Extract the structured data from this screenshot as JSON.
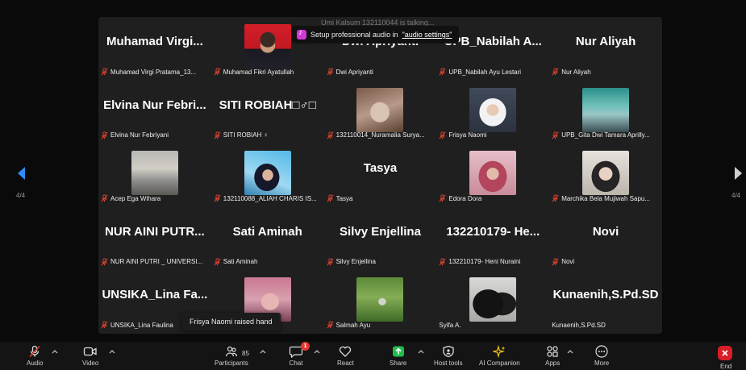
{
  "meeting": {
    "talking_text": "Umi Kalsum 132110044 is talking...",
    "audio_banner": {
      "text": "Setup professional audio in ",
      "link": "\"audio settings\""
    },
    "raised_hand": "Frisya Naomi raised hand",
    "page_left": "4/4",
    "page_right": "4/4"
  },
  "tiles": [
    {
      "big": "Muhamad Virgi...",
      "label": "Muhamad Virgi Pratama_13...",
      "photo": ""
    },
    {
      "big": "",
      "label": "Muhamad Fikri Ayatullah",
      "photo": "portrait-red"
    },
    {
      "big": "Dwi Apriyanti",
      "label": "Dwi Apriyanti",
      "photo": ""
    },
    {
      "big": "UPB_Nabilah A...",
      "label": "UPB_Nabilah Ayu Lestari",
      "photo": ""
    },
    {
      "big": "Nur Aliyah",
      "label": "Nur Aliyah",
      "photo": ""
    },
    {
      "big": "Elvina Nur Febri...",
      "label": "Elvina Nur Febriyani",
      "photo": ""
    },
    {
      "big": "SITI ROBIAH□♂□",
      "label": "SITI ROBIAH ♀",
      "photo": ""
    },
    {
      "big": "",
      "label": "132110014_Nuramalia Surya...",
      "photo": "selfie-light"
    },
    {
      "big": "",
      "label": "Frisya Naomi",
      "photo": "hijab-white"
    },
    {
      "big": "",
      "label": "UPB_Gita Dwi Tamara Aprilly...",
      "photo": "outdoor-teal"
    },
    {
      "big": "",
      "label": "Acep Ega Wihara",
      "photo": "street"
    },
    {
      "big": "",
      "label": "132110088_ALIAH CHARIS IS...",
      "photo": "hijab-sky"
    },
    {
      "big": "Tasya",
      "label": "Tasya",
      "photo": ""
    },
    {
      "big": "",
      "label": "Edora Dora",
      "photo": "hijab-pink"
    },
    {
      "big": "",
      "label": "Marchika Bela Mujiwah Sapu...",
      "photo": "hijab-dark"
    },
    {
      "big": "NUR AINI PUTR...",
      "label": "NUR AINI PUTRI _ UNIVERSI...",
      "photo": ""
    },
    {
      "big": "Sati Aminah",
      "label": "Sati Aminah",
      "photo": ""
    },
    {
      "big": "Silvy Enjellina",
      "label": "Silvy Enjellina",
      "photo": ""
    },
    {
      "big": "132210179- He...",
      "label": "132210179- Heni Nuraini",
      "photo": ""
    },
    {
      "big": "Novi",
      "label": "Novi",
      "photo": ""
    },
    {
      "big": "UNSIKA_Lina Fa...",
      "label": "UNSIKA_Lina Faulina",
      "photo": ""
    },
    {
      "big": "",
      "label": "",
      "photo": "selfie-pink"
    },
    {
      "big": "",
      "label": "Salmah Ayu",
      "photo": "garden"
    },
    {
      "big": "",
      "label": "Syifa A.",
      "photo": "black-hijab",
      "no_mic": true
    },
    {
      "big": "Kunaenih,S.Pd.SD",
      "label": "Kunaenih,S.Pd.SD",
      "photo": "",
      "no_mic": true
    }
  ],
  "toolbar": {
    "audio": "Audio",
    "video": "Video",
    "participants": "Participants",
    "participants_count": "85",
    "chat": "Chat",
    "chat_badge": "1",
    "react": "React",
    "share": "Share",
    "host_tools": "Host tools",
    "ai_companion": "AI Companion",
    "apps": "Apps",
    "more": "More",
    "end": "End"
  },
  "colors": {
    "mic_muted": "#e0432f",
    "share_green": "#1fbf4a",
    "end_red": "#d81e27",
    "ai_yellow": "#f2c21b"
  }
}
